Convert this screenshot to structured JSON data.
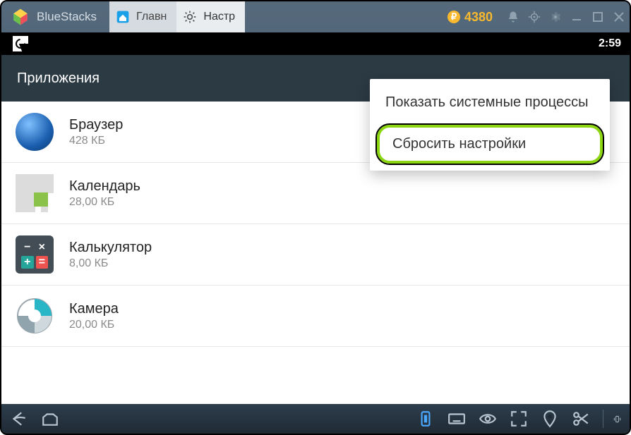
{
  "window": {
    "app_name": "BlueStacks",
    "tabs": [
      {
        "label": "Главн",
        "icon": "home-icon"
      },
      {
        "label": "Настр",
        "icon": "gear-icon"
      }
    ],
    "coin_balance": "4380"
  },
  "statusbar": {
    "time": "2:59"
  },
  "section": {
    "title": "Приложения"
  },
  "apps": [
    {
      "name": "Браузер",
      "size": "428 КБ"
    },
    {
      "name": "Календарь",
      "size": "28,00 КБ"
    },
    {
      "name": "Калькулятор",
      "size": "8,00 КБ"
    },
    {
      "name": "Камера",
      "size": "20,00 КБ"
    }
  ],
  "popup": {
    "items": [
      {
        "label": "Показать системные процессы",
        "highlight": false
      },
      {
        "label": "Сбросить настройки",
        "highlight": true
      }
    ]
  }
}
